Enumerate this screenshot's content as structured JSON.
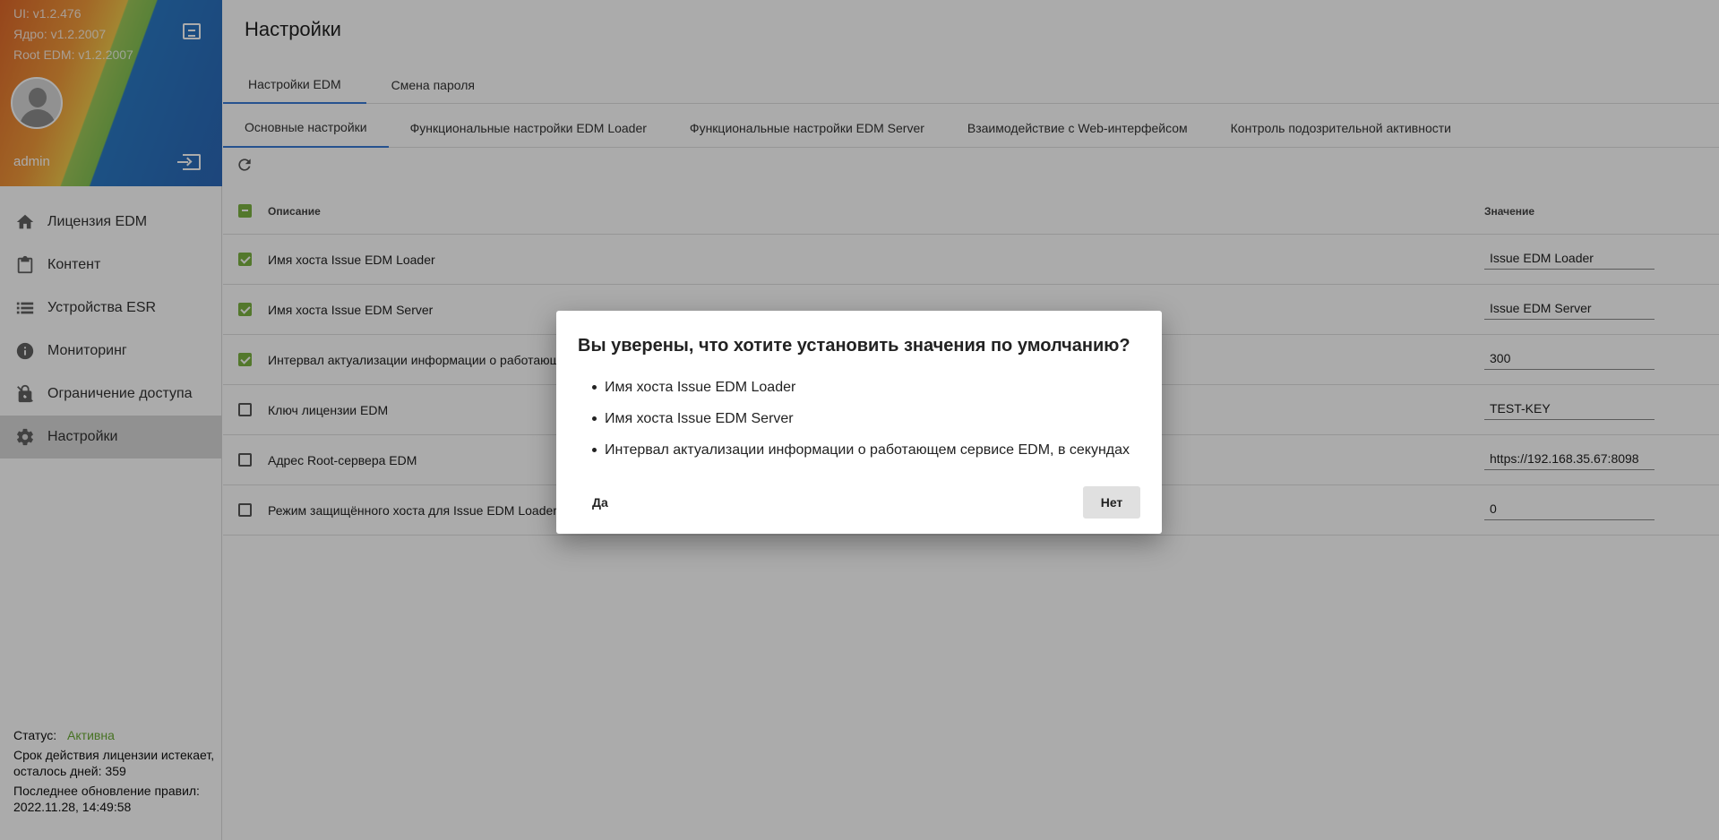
{
  "sidebar": {
    "versions": {
      "ui": "UI: v1.2.476",
      "core": "Ядро: v1.2.2007",
      "root": "Root EDM: v1.2.2007"
    },
    "username": "admin",
    "nav": [
      {
        "label": "Лицензия EDM",
        "icon": "home-icon"
      },
      {
        "label": "Контент",
        "icon": "clipboard-icon"
      },
      {
        "label": "Устройства ESR",
        "icon": "list-icon"
      },
      {
        "label": "Мониторинг",
        "icon": "info-icon"
      },
      {
        "label": "Ограничение доступа",
        "icon": "lock-icon"
      },
      {
        "label": "Настройки",
        "icon": "gear-icon",
        "active": true
      }
    ],
    "status": {
      "label": "Статус:",
      "value": "Активна",
      "license": "Срок действия лицензии истекает, осталось дней: 359",
      "updated": "Последнее обновление правил: 2022.11.28, 14:49:58"
    }
  },
  "main": {
    "title": "Настройки",
    "tabs": [
      "Настройки EDM",
      "Смена пароля"
    ],
    "subtabs": [
      "Основные настройки",
      "Функциональные настройки EDM Loader",
      "Функциональные настройки EDM Server",
      "Взаимодействие с Web-интерфейсом",
      "Контроль подозрительной активности"
    ],
    "table": {
      "headers": {
        "description": "Описание",
        "value": "Значение"
      },
      "rows": [
        {
          "description": "Имя хоста Issue EDM Loader",
          "value": "Issue EDM Loader",
          "checked": true
        },
        {
          "description": "Имя хоста Issue EDM Server",
          "value": "Issue EDM Server",
          "checked": true
        },
        {
          "description": "Интервал актуализации информации о работающем сервисе EDM, в секундах",
          "value": "300",
          "checked": true
        },
        {
          "description": "Ключ лицензии EDM",
          "value": "TEST-KEY",
          "checked": false
        },
        {
          "description": "Адрес Root-сервера EDM",
          "value": "https://192.168.35.67:8098",
          "checked": false
        },
        {
          "description": "Режим защищённого хоста для Issue EDM Loader",
          "value": "0",
          "checked": false
        }
      ]
    }
  },
  "dialog": {
    "title": "Вы уверены, что хотите установить значения по умолчанию?",
    "items": [
      "Имя хоста Issue EDM Loader",
      "Имя хоста Issue EDM Server",
      "Интервал актуализации информации о работающем сервисе EDM, в секундах"
    ],
    "yes": "Да",
    "no": "Нет"
  },
  "colors": {
    "accent_green": "#7cb342",
    "status_green": "#6aab35",
    "tab_underline": "#3a7bd5"
  }
}
